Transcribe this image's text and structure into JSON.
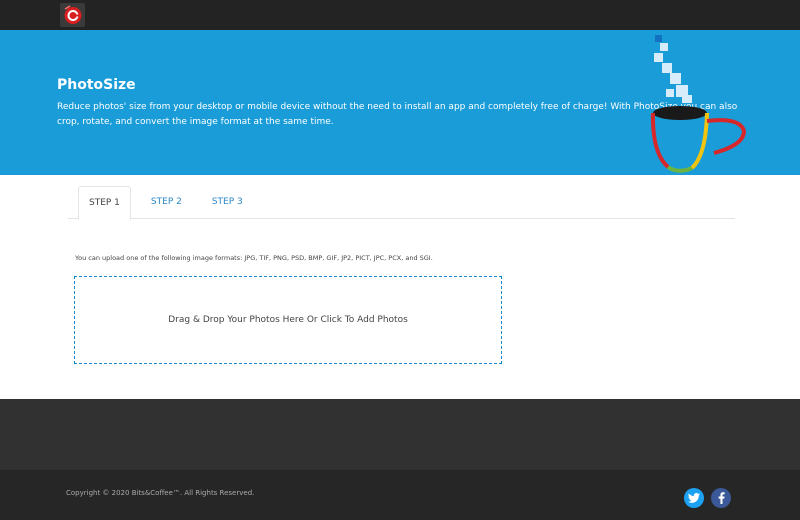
{
  "hero": {
    "title": "PhotoSize",
    "description": "Reduce photos' size from your desktop or mobile device without the need to install an app and completely free of charge! With PhotoSize you can also crop, rotate, and convert the image format at the same time."
  },
  "tabs": [
    {
      "label": "STEP 1",
      "active": true
    },
    {
      "label": "STEP 2",
      "active": false
    },
    {
      "label": "STEP 3",
      "active": false
    }
  ],
  "upload": {
    "formats_text": "You can upload one of the following image formats: JPG, TIF, PNG, PSD, BMP, GIF, JP2, PICT, JPC, PCX, and SGI.",
    "dropzone_text": "Drag & Drop Your Photos Here Or Click To Add Photos"
  },
  "footer": {
    "copyright": "Copyright © 2020 Bits&Coffee™. All Rights Reserved.",
    "social": [
      "twitter-icon",
      "facebook-icon"
    ]
  },
  "colors": {
    "hero_bg": "#199cd8",
    "topbar_bg": "#232323",
    "tab_link": "#2b86c5",
    "dropzone_border": "#1a8ad0"
  }
}
